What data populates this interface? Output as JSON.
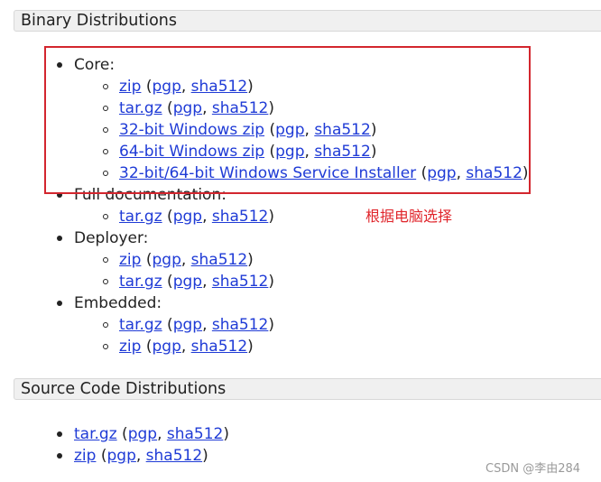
{
  "sections": {
    "binary_title": "Binary Distributions",
    "source_title": "Source Code Distributions"
  },
  "binary": {
    "core": {
      "label": "Core:",
      "items": [
        {
          "main": "zip",
          "sig1": "pgp",
          "sig2": "sha512"
        },
        {
          "main": "tar.gz",
          "sig1": "pgp",
          "sig2": "sha512"
        },
        {
          "main": "32-bit Windows zip",
          "sig1": "pgp",
          "sig2": "sha512"
        },
        {
          "main": "64-bit Windows zip",
          "sig1": "pgp",
          "sig2": "sha512"
        },
        {
          "main": "32-bit/64-bit Windows Service Installer",
          "sig1": "pgp",
          "sig2": "sha512"
        }
      ]
    },
    "full_doc": {
      "label": "Full documentation:",
      "items": [
        {
          "main": "tar.gz",
          "sig1": "pgp",
          "sig2": "sha512"
        }
      ]
    },
    "deployer": {
      "label": "Deployer:",
      "items": [
        {
          "main": "zip",
          "sig1": "pgp",
          "sig2": "sha512"
        },
        {
          "main": "tar.gz",
          "sig1": "pgp",
          "sig2": "sha512"
        }
      ]
    },
    "embedded": {
      "label": "Embedded:",
      "items": [
        {
          "main": "tar.gz",
          "sig1": "pgp",
          "sig2": "sha512"
        },
        {
          "main": "zip",
          "sig1": "pgp",
          "sig2": "sha512"
        }
      ]
    }
  },
  "source": {
    "items": [
      {
        "main": "tar.gz",
        "sig1": "pgp",
        "sig2": "sha512"
      },
      {
        "main": "zip",
        "sig1": "pgp",
        "sig2": "sha512"
      }
    ]
  },
  "annotation": "根据电脑选择",
  "watermark": "CSDN @李由284",
  "punct": {
    "open": " (",
    "sep": ", ",
    "close": ")"
  },
  "colors": {
    "link": "#1f3bd6",
    "annotation": "#e0252b",
    "box": "#d3262e",
    "header_bg": "#f0f0f0"
  }
}
